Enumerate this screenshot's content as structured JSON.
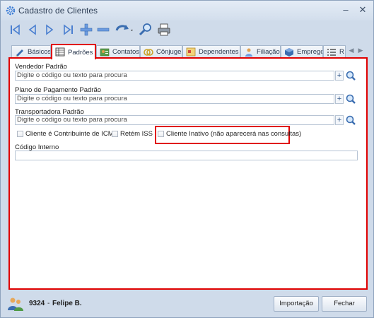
{
  "window": {
    "title": "Cadastro de Clientes",
    "minimize": "–",
    "close": "✕"
  },
  "toolbar": {
    "buttons": [
      {
        "icon": "first-record-icon"
      },
      {
        "icon": "previous-record-icon"
      },
      {
        "icon": "next-record-icon"
      },
      {
        "icon": "last-record-icon"
      },
      {
        "icon": "add-icon"
      },
      {
        "icon": "remove-icon"
      },
      {
        "icon": "undo-icon"
      },
      {
        "icon": "search-icon"
      },
      {
        "icon": "print-icon"
      }
    ]
  },
  "tabs": [
    {
      "label": "Básicos",
      "icon": "pencil-icon"
    },
    {
      "label": "Padrões",
      "icon": "table-icon",
      "active": true
    },
    {
      "label": "Contatos",
      "icon": "contacts-icon"
    },
    {
      "label": "Cônjuge",
      "icon": "spouse-icon"
    },
    {
      "label": "Dependentes",
      "icon": "dependents-icon"
    },
    {
      "label": "Filiação",
      "icon": "parents-icon"
    },
    {
      "label": "Emprego",
      "icon": "employment-icon"
    },
    {
      "label": "R",
      "icon": "list-icon"
    }
  ],
  "form": {
    "vendedor": {
      "label": "Vendedor Padrão",
      "placeholder": "Digite o código ou texto para procura"
    },
    "plano": {
      "label": "Plano de Pagamento Padrão",
      "placeholder": "Digite o código ou texto para procura"
    },
    "transportadora": {
      "label": "Transportadora Padrão",
      "placeholder": "Digite o código ou texto para procura"
    },
    "plus_label": "+",
    "checkboxes": {
      "icms": "Cliente é Contribuinte de ICMS",
      "iss": "Retém ISS",
      "inativo": "Cliente Inativo (não aparecerá nas consultas)"
    },
    "codigo_interno": {
      "label": "Código Interno",
      "value": ""
    }
  },
  "footer": {
    "user_code": "9324",
    "separator": "-",
    "user_name": "Felipe B.",
    "import_button": "Importação",
    "close_button": "Fechar"
  },
  "colors": {
    "highlight": "#e00000",
    "frame": "#cfdbea",
    "accent": "#3a6db0"
  }
}
